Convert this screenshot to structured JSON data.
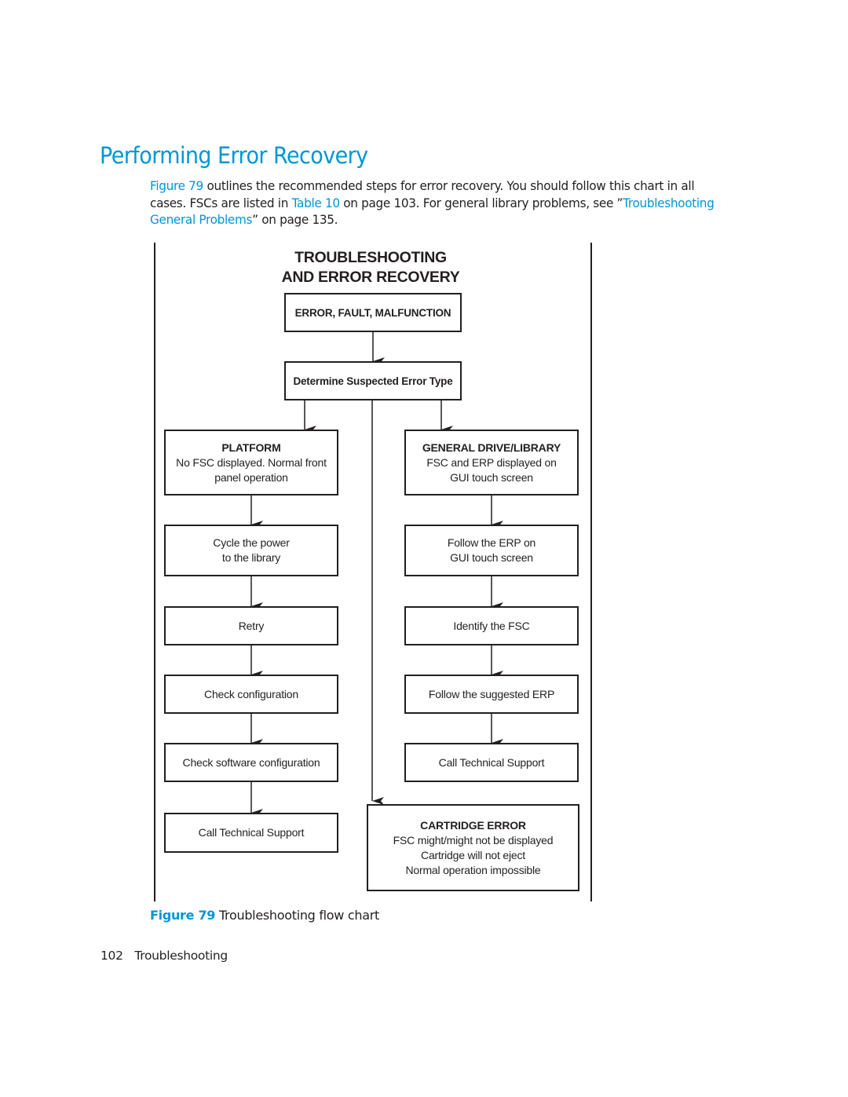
{
  "heading": "Performing Error Recovery",
  "intro": {
    "link_figure": "Figure 79",
    "text_1": " outlines the recommended steps for error recovery. You should follow this chart in all cases. FSCs are listed in ",
    "link_table": "Table 10",
    "text_2": " on page 103. For general library problems, see ”",
    "link_section": "Troubleshooting General Problems",
    "text_3": "” on page 135."
  },
  "flowchart": {
    "title_line1": "TROUBLESHOOTING",
    "title_line2": "AND ERROR RECOVERY",
    "start": "ERROR, FAULT, MALFUNCTION",
    "determine": "Determine Suspected Error Type",
    "platform": {
      "heading": "PLATFORM",
      "line1": "No FSC displayed. Normal front",
      "line2": "panel operation",
      "steps": [
        {
          "line1": "Cycle the power",
          "line2": "to the library"
        },
        {
          "line1": "Retry"
        },
        {
          "line1": "Check configuration"
        },
        {
          "line1": "Check software configuration"
        },
        {
          "line1": "Call Technical Support"
        }
      ]
    },
    "general": {
      "heading": "GENERAL DRIVE/LIBRARY",
      "line1": "FSC and ERP displayed on",
      "line2": "GUI touch screen",
      "steps": [
        {
          "line1": "Follow the ERP on",
          "line2": "GUI touch screen"
        },
        {
          "line1": "Identify the FSC"
        },
        {
          "line1": "Follow the suggested ERP"
        },
        {
          "line1": "Call Technical Support"
        }
      ]
    },
    "cartridge": {
      "heading": "CARTRIDGE ERROR",
      "line1": "FSC might/might not be displayed",
      "line2": "Cartridge will not eject",
      "line3": "Normal operation impossible"
    }
  },
  "caption": {
    "label": "Figure 79",
    "text": "Troubleshooting flow chart"
  },
  "footer": {
    "page_number": "102",
    "section": "Troubleshooting"
  }
}
